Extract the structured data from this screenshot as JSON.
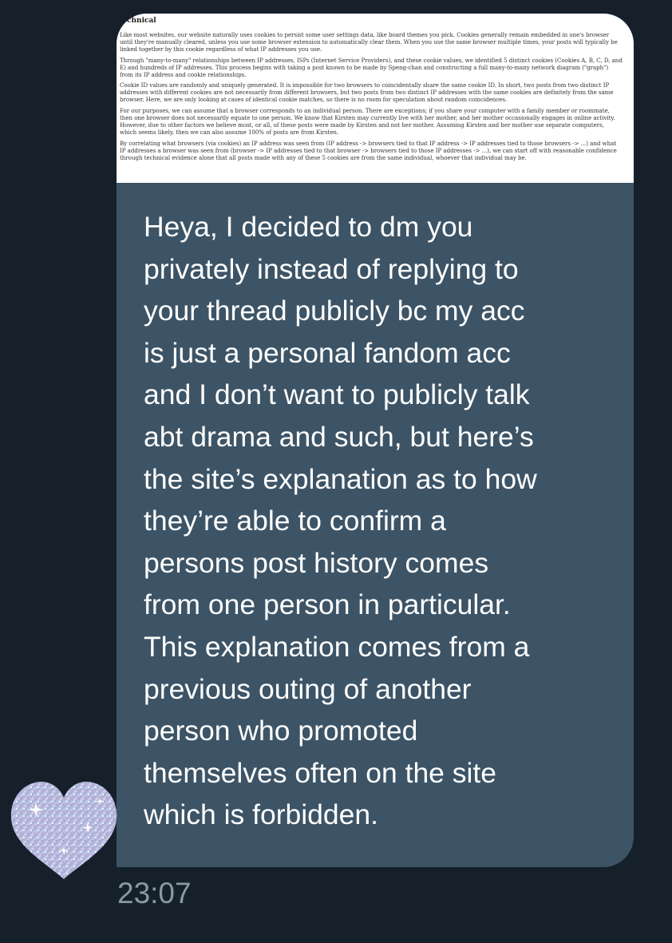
{
  "message": {
    "attachment": {
      "title": "chnical",
      "paragraphs": [
        "Like most websites, our website naturally uses cookies to persist some user settings data, like board themes you pick. Cookies generally remain embedded in one's browser until they're manually cleared, unless you use some browser extension to automatically clear them. When you use the same browser multiple times, your posts will typically be linked together by this cookie regardless of what IP addresses you use.",
        "Through \"many-to-many\" relationships between IP addresses, ISPs (Internet Service Providers), and these cookie values, we identified 5 distinct cookies (Cookies A, B, C, D, and E) and hundreds of IP addresses. This process begins with taking a post known to be made by Speng-chan and constructing a full many-to-many network diagram (\"graph\") from its IP address and cookie relationships.",
        "Cookie ID values are randomly and uniquely generated. It is impossible for two browsers to coincidentally share the same cookie ID. In short, two posts from two distinct IP addresses with different cookies are not necessarily from different browsers, but two posts from two distinct IP addresses with the same cookies are definitely from the same browser. Here, we are only looking at cases of identical cookie matches, so there is no room for speculation about random coincidences.",
        "For our purposes, we can assume that a browser corresponds to an individual person. There are exceptions; if you share your computer with a family member or roommate, then one browser does not necessarily equate to one person. We know that Kirsten may currently live with her mother, and her mother occasionally engages in online activity. However, due to other factors we believe most, or all, of these posts were made by Kirsten and not her mother. Assuming Kirsten and her mother use separate computers, which seems likely, then we can also assume 100% of posts are from Kirsten.",
        "By correlating what browsers (via cookies) an IP address was seen from (IP address -> browsers tied to that IP address -> IP addresses tied to those browsers -> ...) and what IP addresses a browser was seen from (browser -> IP addresses tied to that browser -> browsers tied to those IP addresses -> ...), we can start off with reasonable confidence through technical evidence alone that all posts made with any of these 5 cookies are from the same individual, whoever that individual may be."
      ]
    },
    "text": "Heya, I decided to dm you\nprivately instead of replying to\nyour thread publicly bc my acc\nis just a personal fandom acc\nand I don’t want to publicly talk\nabt drama and such, but here’s\nthe site’s explanation as to how\nthey’re able to confirm a\npersons post history comes\nfrom one person in particular.\nThis explanation comes from a\nprevious outing of another\nperson who promoted\nthemselves often on the site\nwhich is forbidden.",
    "timestamp": "23:07"
  },
  "avatar": {
    "icon": "glitter-heart-icon"
  },
  "colors": {
    "background": "#15202b",
    "bubble": "#3d5466",
    "text": "#ffffff",
    "timestamp": "#8899a6"
  }
}
